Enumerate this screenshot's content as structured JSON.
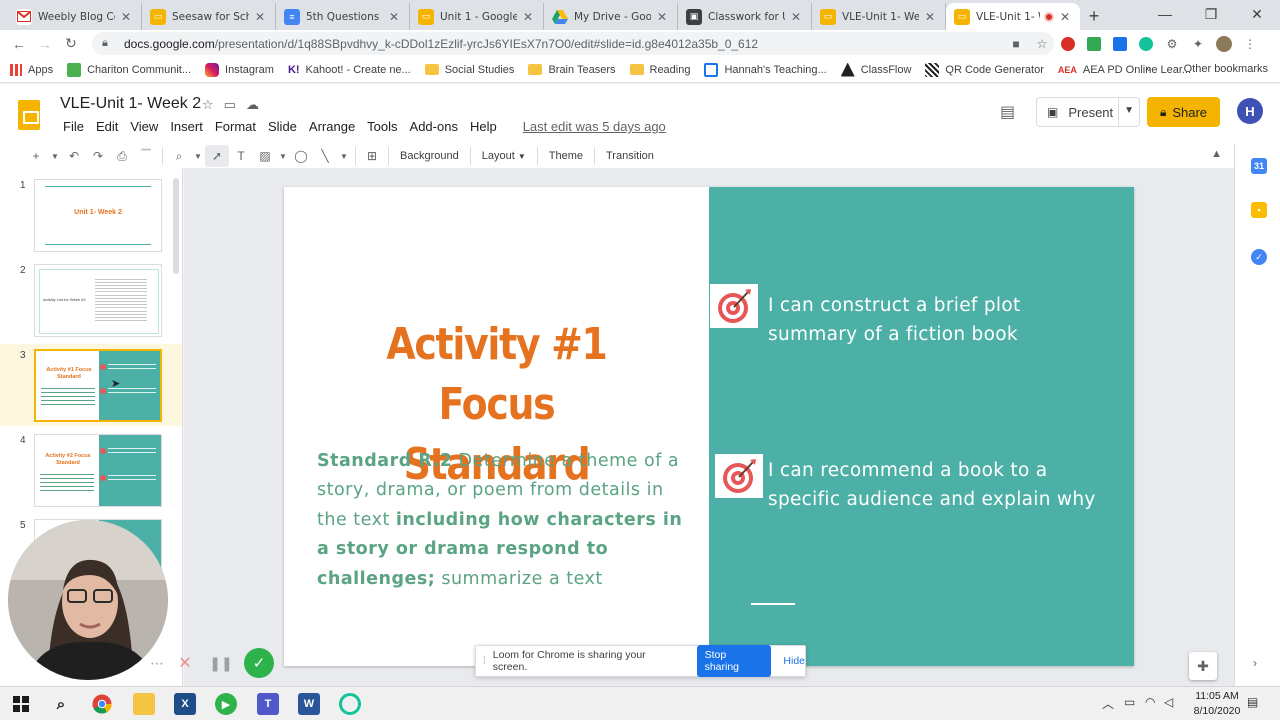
{
  "browser": {
    "tabs": [
      {
        "label": "Weebly Blog Comm",
        "icon": "gmail-icon",
        "color": "#ffffff"
      },
      {
        "label": "Seesaw for School",
        "icon": "slides-icon",
        "color": "#f4b400"
      },
      {
        "label": "5th Questions RTL",
        "icon": "docs-icon",
        "color": "#4285f4"
      },
      {
        "label": "Unit 1 - Google Sli",
        "icon": "slides-icon",
        "color": "#f4b400"
      },
      {
        "label": "My Drive - Google",
        "icon": "drive-icon",
        "color": "#1fa463"
      },
      {
        "label": "Classwork for Unit",
        "icon": "classroom-icon",
        "color": "#3c4043"
      },
      {
        "label": "VLE-Unit 1- Week",
        "icon": "slides-icon",
        "color": "#f4b400"
      },
      {
        "label": "VLE-Unit 1- W",
        "icon": "slides-icon",
        "color": "#f4b400",
        "active": true
      }
    ],
    "url_domain": "docs.google.com",
    "url_path": "/presentation/d/1q88SBpvdhvy_k-cDDol1zEzlif-yrcJs6YIEsX7n7O0/edit#slide=id.g8e4012a35b_0_612",
    "bookmarks": [
      {
        "label": "Apps",
        "icon": "apps-icon"
      },
      {
        "label": "Chariton Communit...",
        "icon": "site-icon"
      },
      {
        "label": "Instagram",
        "icon": "instagram-icon"
      },
      {
        "label": "Kahoot! - Create ne...",
        "icon": "kahoot-icon"
      },
      {
        "label": "Social Studies",
        "icon": "folder-icon"
      },
      {
        "label": "Brain Teasers",
        "icon": "folder-icon"
      },
      {
        "label": "Reading",
        "icon": "folder-icon"
      },
      {
        "label": "Hannah's Teaching...",
        "icon": "site-icon"
      },
      {
        "label": "ClassFlow",
        "icon": "site-icon"
      },
      {
        "label": "QR Code Generator",
        "icon": "site-icon"
      },
      {
        "label": "AEA PD Online Lear...",
        "icon": "site-icon"
      }
    ],
    "other_bookmarks": "Other bookmarks",
    "overflow_chevron": "»"
  },
  "app": {
    "title": "VLE-Unit 1- Week 2",
    "menu": [
      "File",
      "Edit",
      "View",
      "Insert",
      "Format",
      "Slide",
      "Arrange",
      "Tools",
      "Add-ons",
      "Help"
    ],
    "last_edit": "Last edit was 5 days ago",
    "present_label": "Present",
    "share_label": "Share",
    "avatar_initial": "H",
    "toolbar": {
      "background": "Background",
      "layout": "Layout",
      "theme": "Theme",
      "transition": "Transition"
    }
  },
  "filmstrip": {
    "slides": [
      {
        "number": "1",
        "title": "Unit 1- Week 2"
      },
      {
        "number": "2",
        "title": "Activity List for Week #2"
      },
      {
        "number": "3",
        "title": "Activity #1 Focus Standard",
        "selected": true
      },
      {
        "number": "4",
        "title": "Activity #2 Focus Standard"
      },
      {
        "number": "5",
        "title": ""
      }
    ]
  },
  "slide": {
    "title_line1": "Activity #1 Focus",
    "title_line2": "Standard",
    "body_bold1": "Standard R.2",
    "body_text1": " Determine a theme of a story, drama, or poem from details in the text ",
    "body_bold2": "including how characters in a story or drama respond to challenges;",
    "body_text2": " summarize a text",
    "goal1": "I can construct a brief plot summary of a fiction book",
    "goal2": "I can recommend a book to a specific audience and explain why",
    "colors": {
      "title": "#e5721e",
      "body": "#5aa383",
      "panel": "#4db0a7"
    }
  },
  "loom": {
    "message": "Loom for Chrome is sharing your screen.",
    "stop_label": "Stop sharing",
    "hide_label": "Hide"
  },
  "taskbar": {
    "time": "11:05 AM",
    "date": "8/10/2020"
  }
}
